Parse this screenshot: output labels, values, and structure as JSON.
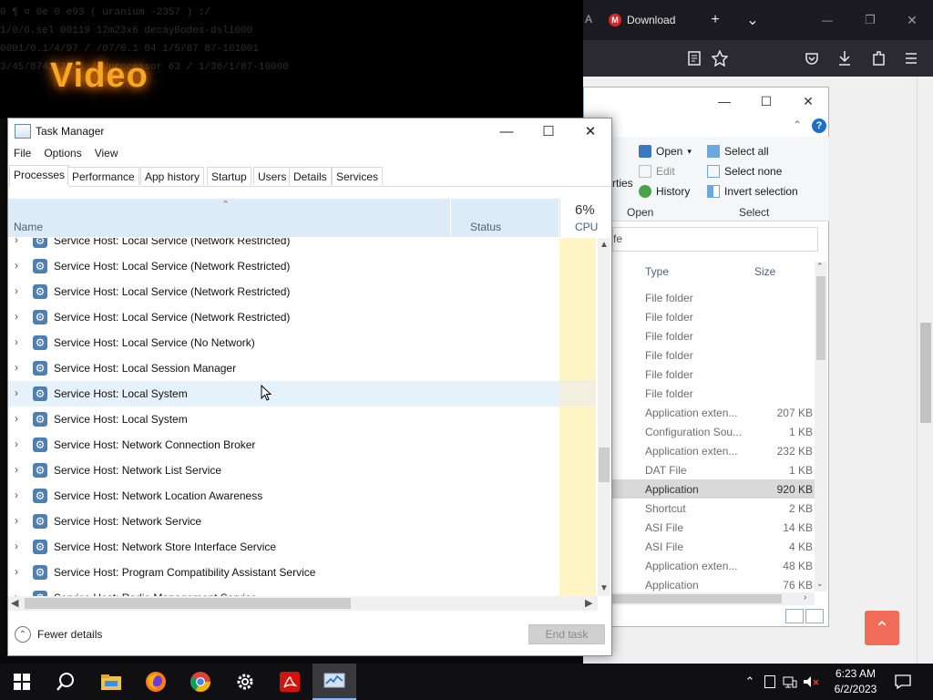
{
  "background_video": {
    "word": "Video",
    "code_lines": [
      "0 ¶ ¤ 0e 0 e93 ( uranium -2357 ) ↕/",
      "1/0/0.sel 00119 12m23x6 decayBodes-dsl1000",
      "0001/0.1/4/97 / /07/0.1 04 1/5/87 87-101001",
      "3/45/8741/3/44 / Uprocessor 63 / 1/36/1/87-10000"
    ]
  },
  "browser": {
    "tab_label": "Download",
    "tab_partial": "A",
    "icons": {
      "mega": "M",
      "new_tab": "+",
      "list_tabs": "⌄",
      "minimize": "—",
      "restore": "❐",
      "close": "✕"
    },
    "toolbar_icons": [
      "reader-view-icon",
      "bookmark-star-icon",
      "pocket-icon",
      "download-icon",
      "extensions-icon",
      "menu-icon"
    ],
    "back_to_top": "⌃"
  },
  "explorer": {
    "ribbon": {
      "partial_left": "rties",
      "open": "Open",
      "edit": "Edit",
      "history": "History",
      "select_all": "Select all",
      "select_none": "Select none",
      "invert_selection": "Invert selection",
      "group_open": "Open",
      "group_select": "Select"
    },
    "address_partial": "fe",
    "columns": {
      "type": "Type",
      "size": "Size"
    },
    "rows": [
      {
        "type": "File folder",
        "size": ""
      },
      {
        "type": "File folder",
        "size": ""
      },
      {
        "type": "File folder",
        "size": ""
      },
      {
        "type": "File folder",
        "size": ""
      },
      {
        "type": "File folder",
        "size": ""
      },
      {
        "type": "File folder",
        "size": ""
      },
      {
        "type": "Application exten...",
        "size": "207 KB"
      },
      {
        "type": "Configuration Sou...",
        "size": "1 KB"
      },
      {
        "type": "Application exten...",
        "size": "232 KB"
      },
      {
        "type": "DAT File",
        "size": "1 KB"
      },
      {
        "type": "Application",
        "size": "920 KB"
      },
      {
        "type": "Shortcut",
        "size": "2 KB"
      },
      {
        "type": "ASI File",
        "size": "14 KB"
      },
      {
        "type": "ASI File",
        "size": "4 KB"
      },
      {
        "type": "Application exten...",
        "size": "48 KB"
      },
      {
        "type": "Application",
        "size": "76 KB"
      }
    ],
    "selected_row_index": 10
  },
  "task_manager": {
    "title": "Task Manager",
    "menu": [
      "File",
      "Options",
      "View"
    ],
    "tabs": [
      "Processes",
      "Performance",
      "App history",
      "Startup",
      "Users",
      "Details",
      "Services"
    ],
    "active_tab": "Processes",
    "columns": {
      "name": "Name",
      "status": "Status",
      "cpu_pct": "6%",
      "cpu_label": "CPU"
    },
    "processes": [
      "Service Host: Local Service (Network Restricted)",
      "Service Host: Local Service (Network Restricted)",
      "Service Host: Local Service (Network Restricted)",
      "Service Host: Local Service (Network Restricted)",
      "Service Host: Local Service (No Network)",
      "Service Host: Local Session Manager",
      "Service Host: Local System",
      "Service Host: Local System",
      "Service Host: Network Connection Broker",
      "Service Host: Network List Service",
      "Service Host: Network Location Awareness",
      "Service Host: Network Service",
      "Service Host: Network Store Interface Service",
      "Service Host: Program Compatibility Assistant Service",
      "Service Host: Radio Management Service"
    ],
    "hovered_index": 6,
    "fewer_details": "Fewer details",
    "end_task": "End task"
  },
  "taskbar": {
    "apps": [
      "start-icon",
      "search-icon",
      "file-explorer-icon",
      "firefox-icon",
      "chrome-icon",
      "settings-icon",
      "acrobat-icon",
      "task-manager-icon"
    ],
    "time": "6:23 AM",
    "date": "6/2/2023"
  },
  "colors": {
    "header_blue": "#ddebf7",
    "cpu_yellow": "#fff4c4",
    "taskbar": "#101013",
    "firefox_dark": "#2b2a33",
    "back_to_top": "#f26c5a"
  }
}
